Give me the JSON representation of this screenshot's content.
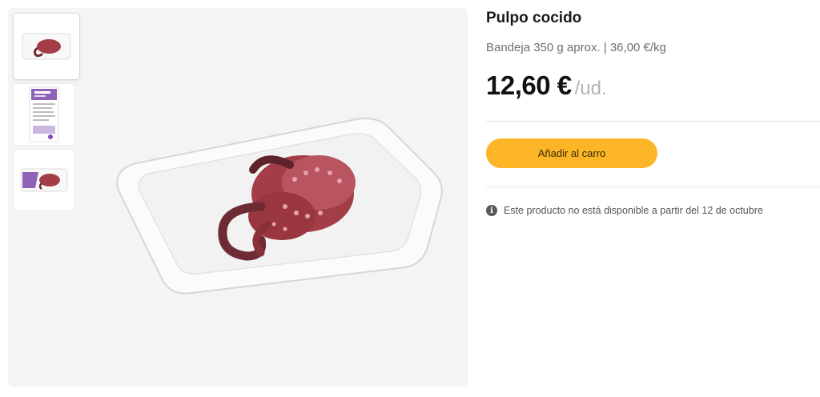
{
  "product": {
    "title": "Pulpo cocido",
    "subtitle": "Bandeja 350 g aprox. | 36,00 €/kg",
    "price": "12,60 €",
    "unit": "/ud.",
    "add_to_cart_label": "Añadir al carro",
    "notice": "Este producto no está disponible a partir del 12 de octubre"
  },
  "gallery": {
    "thumbnails": [
      "octopus-tray-front",
      "package-label-back",
      "package-with-label"
    ],
    "selected_index": 0
  },
  "colors": {
    "accent_button": "#fcb527",
    "gallery_background": "#f4f4f4",
    "octopus": "#a33d47",
    "label_purple": "#7b4fa6"
  }
}
